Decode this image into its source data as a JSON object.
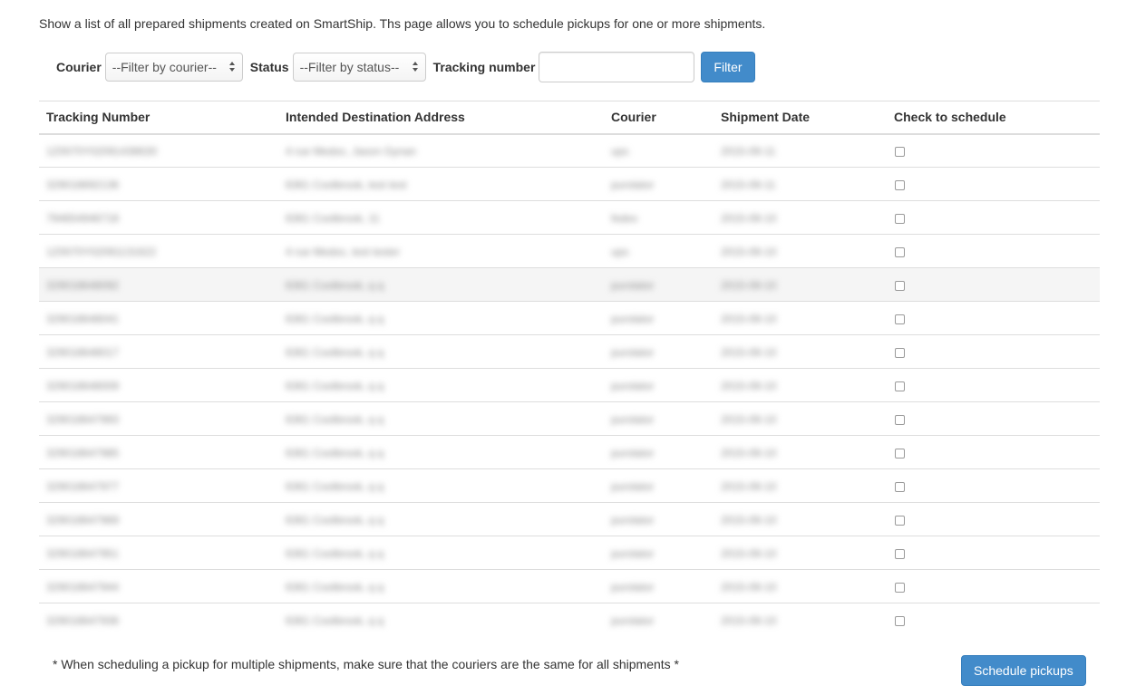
{
  "intro_text": "Show a list of all prepared shipments created on SmartShip. Ths page allows you to schedule pickups for one or more shipments.",
  "filters": {
    "courier_label": "Courier",
    "courier_selected": "--Filter by courier--",
    "status_label": "Status",
    "status_selected": "--Filter by status--",
    "tracking_label": "Tracking number",
    "tracking_value": "",
    "filter_button": "Filter"
  },
  "table": {
    "columns": [
      "Tracking Number",
      "Intended Destination Address",
      "Courier",
      "Shipment Date",
      "Check to schedule"
    ],
    "rows": [
      {
        "tracking": "1Z0070Y02091438630",
        "address": "4 rue Medoc, Jason Gynan",
        "courier": "ups",
        "date": "2015-09-11"
      },
      {
        "tracking": "329018692136",
        "address": "6361 Coolbrook, test test",
        "courier": "purolator",
        "date": "2015-09-11"
      },
      {
        "tracking": "794654946718",
        "address": "6361 Coolbrook, 11",
        "courier": "fedex",
        "date": "2015-09-10"
      },
      {
        "tracking": "1Z0070Y02091131622",
        "address": "4 rue Medoc, test tester",
        "courier": "ups",
        "date": "2015-09-10"
      },
      {
        "tracking": "329018648092",
        "address": "6361 Coolbrook, q q",
        "courier": "purolator",
        "date": "2015-09-10"
      },
      {
        "tracking": "329018648041",
        "address": "6361 Coolbrook, q q",
        "courier": "purolator",
        "date": "2015-09-10"
      },
      {
        "tracking": "329018648017",
        "address": "6361 Coolbrook, q q",
        "courier": "purolator",
        "date": "2015-09-10"
      },
      {
        "tracking": "329018648009",
        "address": "6361 Coolbrook, q q",
        "courier": "purolator",
        "date": "2015-09-10"
      },
      {
        "tracking": "329018647993",
        "address": "6361 Coolbrook, q q",
        "courier": "purolator",
        "date": "2015-09-10"
      },
      {
        "tracking": "329018647985",
        "address": "6361 Coolbrook, q q",
        "courier": "purolator",
        "date": "2015-09-10"
      },
      {
        "tracking": "329018647977",
        "address": "6361 Coolbrook, q q",
        "courier": "purolator",
        "date": "2015-09-10"
      },
      {
        "tracking": "329018647969",
        "address": "6361 Coolbrook, q q",
        "courier": "purolator",
        "date": "2015-09-10"
      },
      {
        "tracking": "329018647951",
        "address": "6361 Coolbrook, q q",
        "courier": "purolator",
        "date": "2015-09-10"
      },
      {
        "tracking": "329018647944",
        "address": "6361 Coolbrook, q q",
        "courier": "purolator",
        "date": "2015-09-10"
      },
      {
        "tracking": "329018647936",
        "address": "6361 Coolbrook, q q",
        "courier": "purolator",
        "date": "2015-09-10"
      }
    ],
    "hover_row_index": 4
  },
  "footnote": "* When scheduling a pickup for multiple shipments, make sure that the couriers are the same for all shipments *",
  "schedule_button": "Schedule pickups",
  "colors": {
    "primary": "#428bca",
    "border": "#dddddd",
    "hover_row": "#f5f5f5"
  }
}
